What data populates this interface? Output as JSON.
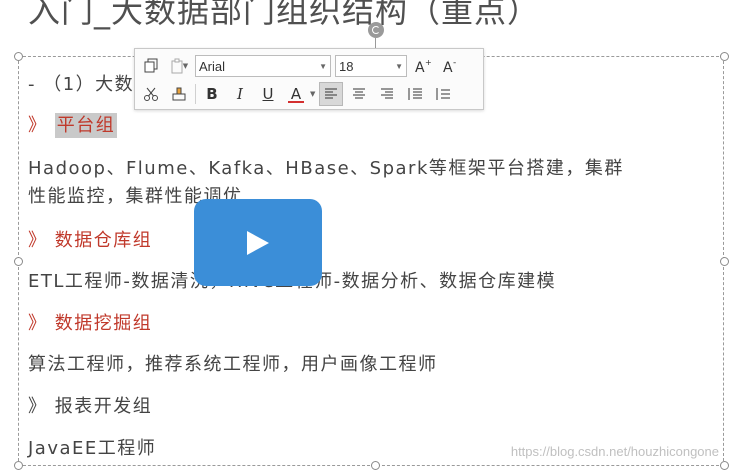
{
  "slide": {
    "title": "入门_大数据部门组织结构（重点）"
  },
  "toolbar": {
    "font_name": "Arial",
    "font_size": "18"
  },
  "content": {
    "line1": "- （1）大数据部门组织结构",
    "line2_marker": "》",
    "line2_text": "平台组",
    "line3": "Hadoop、Flume、Kafka、HBase、Spark等框架平台搭建，集群",
    "line4": "性能监控，集群性能调优",
    "line5_marker": "》",
    "line5_text": "数据仓库组",
    "line6": "ETL工程师-数据清洗，Hive工程师-数据分析、数据仓库建模",
    "line7_marker": "》",
    "line7_text": "数据挖掘组",
    "line8": "算法工程师，推荐系统工程师，用户画像工程师",
    "line9_marker": "》",
    "line9_text": "报表开发组",
    "line10": "JavaEE工程师"
  },
  "watermark": "https://blog.csdn.net/houzhicongone",
  "colors": {
    "accent_red": "#c0392b",
    "play_blue": "#3b8ed8",
    "font_color_bar": "#d32f2f"
  },
  "icons": {
    "play": "play-icon",
    "copy": "copy-icon",
    "paste": "paste-icon",
    "cut": "cut-icon",
    "format_painter": "format-painter-icon"
  }
}
